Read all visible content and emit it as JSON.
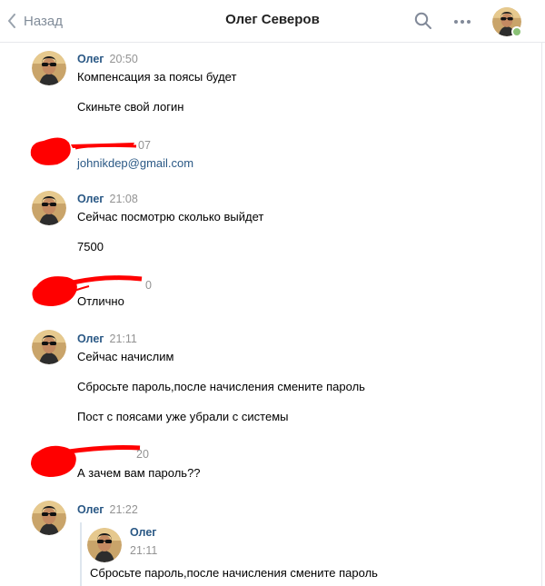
{
  "header": {
    "back_label": "Назад",
    "title": "Олег Северов",
    "icons": [
      "chevron-left-icon",
      "search-icon",
      "more-icon"
    ]
  },
  "colors": {
    "accent": "#2a5885",
    "muted": "#939393",
    "online": "#8ac176",
    "redact": "#ff0000"
  },
  "messages": [
    {
      "sender": "Олег",
      "time": "20:50",
      "lines": [
        "Компенсация за поясы будет",
        "Скиньте свой логин"
      ]
    },
    {
      "sender": "redacted",
      "time": "",
      "lines": [
        "johnikdep@gmail.com"
      ]
    },
    {
      "sender": "Олег",
      "time": "21:08",
      "lines": [
        "Сейчас посмотрю сколько выйдет",
        "7500"
      ]
    },
    {
      "sender": "redacted",
      "time": "",
      "lines": [
        "Отлично"
      ]
    },
    {
      "sender": "Олег",
      "time": "21:11",
      "lines": [
        "Сейчас начислим",
        "Сбросьте пароль,после начисления смените пароль",
        "Пост с поясами уже убрали с системы"
      ]
    },
    {
      "sender": "redacted",
      "time": "",
      "lines": [
        "А зачем вам пароль??"
      ]
    },
    {
      "sender": "Олег",
      "time": "21:22",
      "quote": {
        "sender": "Олег",
        "time": "21:11",
        "text": "Сбросьте пароль,после начисления смените пароль"
      }
    }
  ]
}
